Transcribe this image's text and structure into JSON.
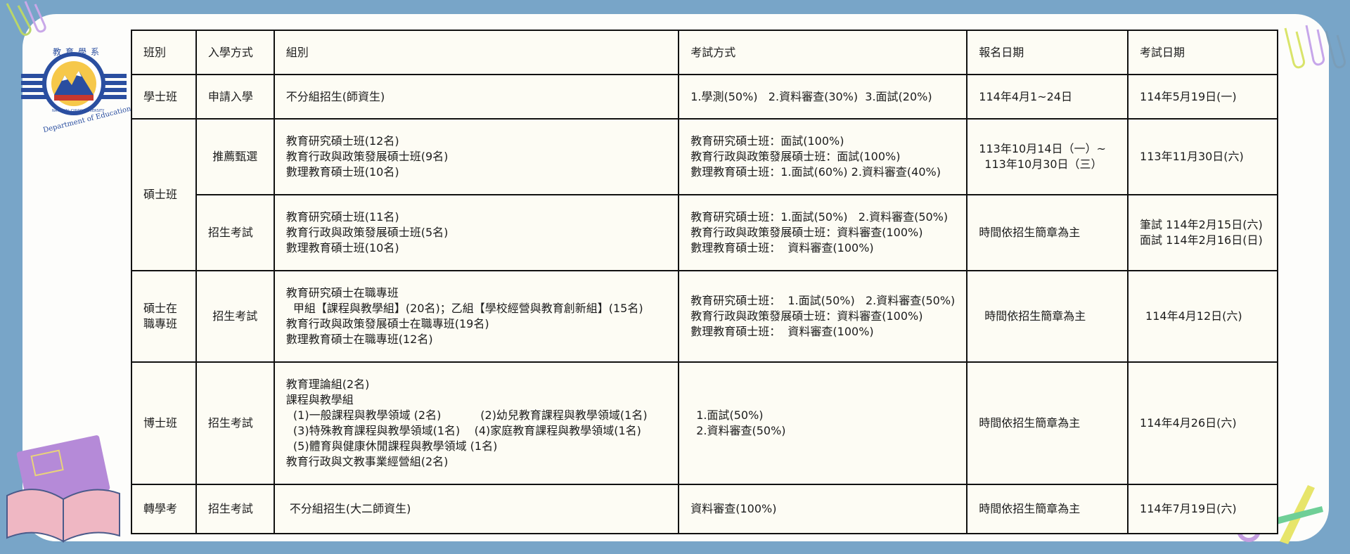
{
  "logo": {
    "name_text": "教育學系",
    "subtitle": "Department of Education",
    "ring_text": "NATIONAL CHIAYI UNIVERSITY"
  },
  "table": {
    "headers": [
      "班別",
      "入學方式",
      "組別",
      "考試方式",
      "報名日期",
      "考試日期"
    ],
    "rows": [
      {
        "class_type": "學士班",
        "admission": "申請入學",
        "groups": [
          "不分組招生(師資生)"
        ],
        "exam": [
          "1.學測(50%)   2.資料審查(30%)  3.面試(20%)"
        ],
        "registration": [
          "114年4月1~24日"
        ],
        "exam_date": [
          "114年5月19日(一)"
        ]
      },
      {
        "class_type": "碩士班",
        "admission": "推薦甄選",
        "groups": [
          "教育研究碩士班(12名)",
          "教育行政與政策發展碩士班(9名)",
          "數理教育碩士班(10名)"
        ],
        "exam": [
          "教育研究碩士班：面試(100%)",
          "教育行政與政策發展碩士班：面試(100%)",
          "數理教育碩士班：1.面試(60%) 2.資料審查(40%)"
        ],
        "registration": [
          "113年10月14日（一）~",
          "113年10月30日（三）"
        ],
        "exam_date": [
          "113年11月30日(六)"
        ]
      },
      {
        "admission": "招生考試",
        "groups": [
          "教育研究碩士班(11名)",
          "教育行政與政策發展碩士班(5名)",
          "數理教育碩士班(10名)"
        ],
        "exam": [
          "教育研究碩士班：1.面試(50%)   2.資料審查(50%)",
          "教育行政與政策發展碩士班：資料審查(100%)",
          "數理教育碩士班：  資料審查(100%)"
        ],
        "registration": [
          "時間依招生簡章為主"
        ],
        "exam_date": [
          "筆試 114年2月15日(六)",
          "面試 114年2月16日(日)"
        ]
      },
      {
        "class_type_lines": [
          "碩士在",
          "職專班"
        ],
        "admission": "招生考試",
        "groups": [
          "教育研究碩士在職專班",
          "  甲組【課程與教學組】(20名)；乙組【學校經營與教育創新組】(15名)",
          "教育行政與政策發展碩士在職專班(19名)",
          "數理教育碩士在職專班(12名)"
        ],
        "exam": [
          "教育研究碩士班：  1.面試(50%)   2.資料審查(50%)",
          "教育行政與政策發展碩士班：資料審查(100%)",
          "數理教育碩士班：  資料審查(100%)"
        ],
        "registration": [
          "時間依招生簡章為主"
        ],
        "exam_date": [
          "114年4月12日(六)"
        ]
      },
      {
        "class_type": "博士班",
        "admission": "招生考試",
        "groups": [
          "教育理論組(2名)",
          "課程與教學組",
          "  (1)一般課程與教學領域 (2名)           (2)幼兒教育課程與教學領域(1名)",
          "  (3)特殊教育課程與教學領域(1名)    (4)家庭教育課程與教學領域(1名)",
          "  (5)體育與健康休閒課程與教學領域 (1名)",
          "教育行政與文教事業經營組(2名)"
        ],
        "exam": [
          "1.面試(50%)",
          "2.資料審查(50%)"
        ],
        "registration": [
          "時間依招生簡章為主"
        ],
        "exam_date": [
          "114年4月26日(六)"
        ]
      },
      {
        "class_type": "轉學考",
        "admission": "招生考試",
        "groups": [
          " 不分組招生(大二師資生)"
        ],
        "exam": [
          "資料審查(100%)"
        ],
        "registration": [
          "時間依招生簡章為主"
        ],
        "exam_date": [
          "114年7月19日(六)"
        ]
      }
    ]
  }
}
